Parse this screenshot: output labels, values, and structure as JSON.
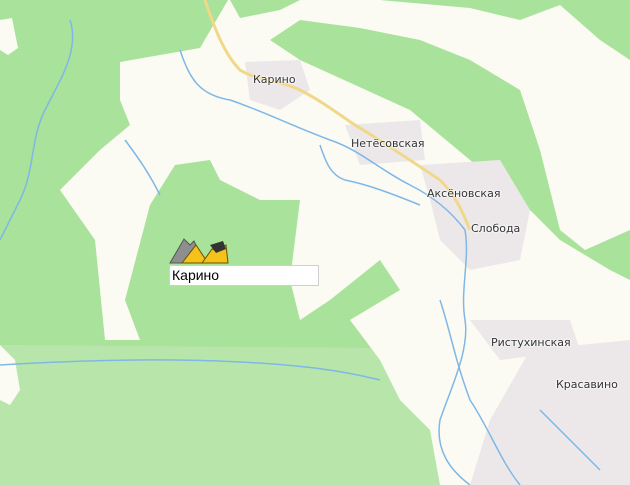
{
  "map": {
    "places": [
      {
        "id": "karino",
        "label": "Карино"
      },
      {
        "id": "netesovskaya",
        "label": "Нетёсовская"
      },
      {
        "id": "aksenovskaya",
        "label": "Аксёновская"
      },
      {
        "id": "sloboda",
        "label": "Слобода"
      },
      {
        "id": "ristukhinskaya",
        "label": "Ристухинская"
      },
      {
        "id": "krasavino",
        "label": "Красавино"
      }
    ],
    "marker": {
      "label": "Карино",
      "icon": "quarry-icon"
    },
    "colors": {
      "forest": "#a9e29a",
      "open_land": "#fbfbf3",
      "settlement": "#ece8ea",
      "road": "#f1d888",
      "river": "#7fb7e6"
    }
  }
}
